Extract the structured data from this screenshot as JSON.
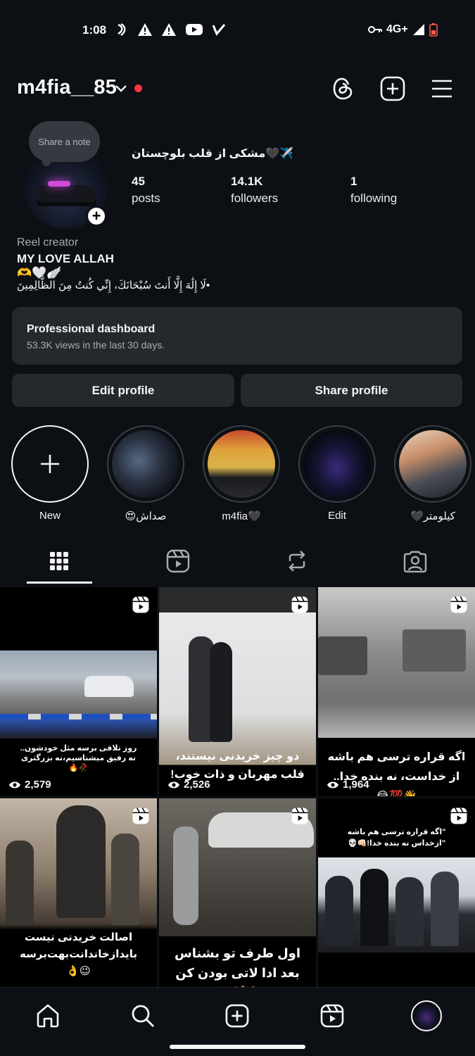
{
  "status_bar": {
    "time": "1:08",
    "network": "4G+",
    "icons": [
      "nfc-icon",
      "alert-icon",
      "alert-icon",
      "youtube-icon",
      "check-icon",
      "vpn-key-icon",
      "signal-icon",
      "battery-icon"
    ]
  },
  "header": {
    "username": "m4fia__85",
    "icons": [
      "threads-icon",
      "create-icon",
      "menu-icon"
    ]
  },
  "note": {
    "label": "Share a note"
  },
  "profile": {
    "display_name": "مشکی از قلب بلوچستان🖤✈️",
    "stats": [
      {
        "value": "45",
        "label": "posts"
      },
      {
        "value": "14.1K",
        "label": "followers"
      },
      {
        "value": "1",
        "label": "following"
      }
    ],
    "category": "Reel creator",
    "bio_line1": "MY LOVE ALLAH",
    "bio_line2": "🫶🤍🪽",
    "bio_line3": "لَا إِلَٰهَ إِلَّا أَنتَ سُبْحَانَكَ، إِنِّي كُنتُ مِنَ الظَّالِمِينَ•"
  },
  "dashboard": {
    "title": "Professional dashboard",
    "subtitle": "53.3K views in the last 30 days."
  },
  "buttons": {
    "edit": "Edit profile",
    "share": "Share profile"
  },
  "highlights": [
    {
      "label": "New"
    },
    {
      "label": "😍صداش"
    },
    {
      "label": "m4fia🖤"
    },
    {
      "label": "Edit"
    },
    {
      "label": "🖤کیلومتر"
    }
  ],
  "tabs": [
    "grid-icon",
    "reels-icon",
    "reposts-icon",
    "tagged-icon"
  ],
  "posts": [
    {
      "views": "2,579",
      "caption": "روز تلافی برسه مثل خودشون..\nنه رفیق میشناسیم،نه بزرگتری\n🥀🔥"
    },
    {
      "views": "2,526",
      "caption": "دو چیز خریدنی نیستند،\nقلب مهربان و ذات خوب!"
    },
    {
      "views": "1,964",
      "caption": "اگه قراره ترسی هم باشه\nاز خداست، نه بنده خدا..\n👋💯😂"
    },
    {
      "views": "",
      "caption": "اصالت خریدنی نیست\nبایدازخاندانت‌بهت‌برسه\n😉👌"
    },
    {
      "views": "",
      "caption": "اول طرف تو بشناس\nبعد ادا لاتی بودن کن\n😂🐒🐷"
    },
    {
      "views": "",
      "caption": "\"اگه قراره ترسی هم باشه\n\"ازخداس نه بنده خدا!👊🏻💀"
    }
  ],
  "bottom_nav": [
    "home-icon",
    "search-icon",
    "create-icon",
    "reels-icon",
    "profile-avatar"
  ]
}
